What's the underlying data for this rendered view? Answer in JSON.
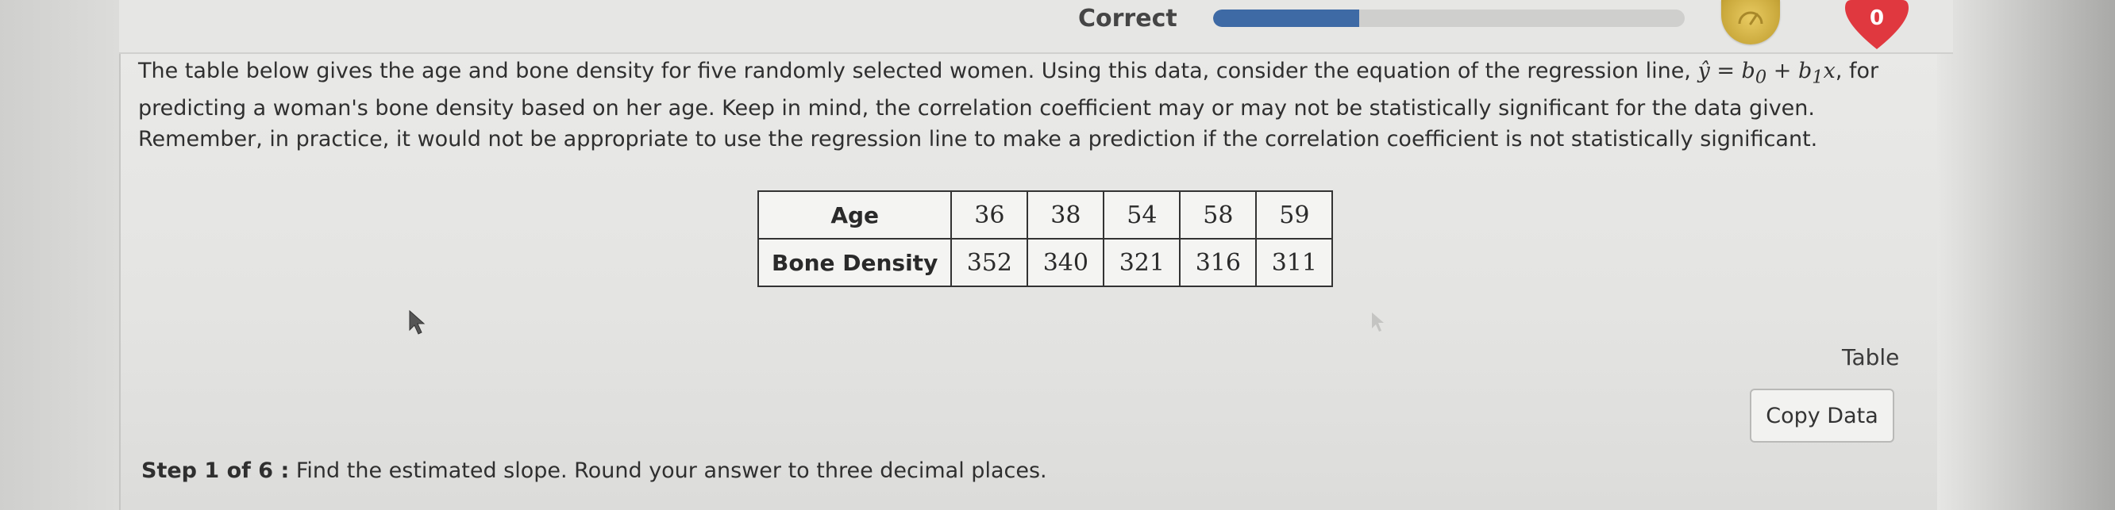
{
  "header": {
    "status": "Correct",
    "progress_fraction": 0.31,
    "hearts_count": "0",
    "accent_color": "#3e6aa5",
    "heart_color": "#e0383f",
    "coin_icon": "gauge-icon",
    "heart_icon": "heart-icon"
  },
  "question": {
    "text_1": "The table below gives the age and bone density for five randomly selected women. Using this data, consider the equation of the regression line, ",
    "eq_lhs": "ŷ",
    "eq_eq": " = ",
    "eq_rhs_b0": "b",
    "eq_rhs_b0_sub": "0",
    "eq_plus": " + ",
    "eq_rhs_b1": "b",
    "eq_rhs_b1_sub": "1",
    "eq_x": "x",
    "text_2": ", for predicting a woman's bone density based on her age. Keep in mind, the correlation coefficient may or may not be statistically significant for the data given. Remember, in practice, it would not be appropriate to use the regression line to make a prediction if the correlation coefficient is not statistically significant."
  },
  "table": {
    "rows": [
      {
        "label": "Age",
        "values": [
          "36",
          "38",
          "54",
          "58",
          "59"
        ]
      },
      {
        "label": "Bone Density",
        "values": [
          "352",
          "340",
          "321",
          "316",
          "311"
        ]
      }
    ]
  },
  "side": {
    "table_link": "Table",
    "copy_button": "Copy Data"
  },
  "step": {
    "label": "Step 1 of 6 :",
    "text": " Find the estimated slope. Round your answer to three decimal places."
  }
}
